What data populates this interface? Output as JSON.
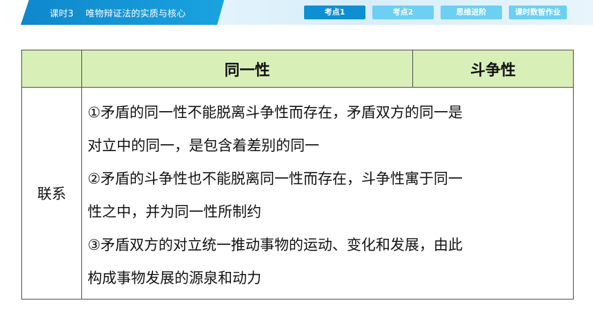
{
  "header": {
    "course_title": "课时3    唯物辩证法的实质与核心",
    "tabs": [
      {
        "label": "考点1",
        "active": true
      },
      {
        "label": "考点2",
        "active": false
      },
      {
        "label": "思维进阶",
        "active": false
      },
      {
        "label": "课时数智作业",
        "active": false
      }
    ]
  },
  "table": {
    "corner": "",
    "col1_header": "同一性",
    "col2_header": "斗争性",
    "row_label": "联系",
    "lines": [
      "①矛盾的同一性不能脱离斗争性而存在，矛盾双方的同一是",
      "对立中的同一，是包含着差别的同一",
      "②矛盾的斗争性也不能脱离同一性而存在，斗争性寓于同一",
      "性之中，并为同一性所制约",
      "③矛盾双方的对立统一推动事物的运动、变化和发展，由此",
      "构成事物发展的源泉和动力"
    ]
  },
  "colors": {
    "accent": "#0e8fd4",
    "tab_inactive": "#6ccff3",
    "header_fill": "#d9efb8"
  }
}
